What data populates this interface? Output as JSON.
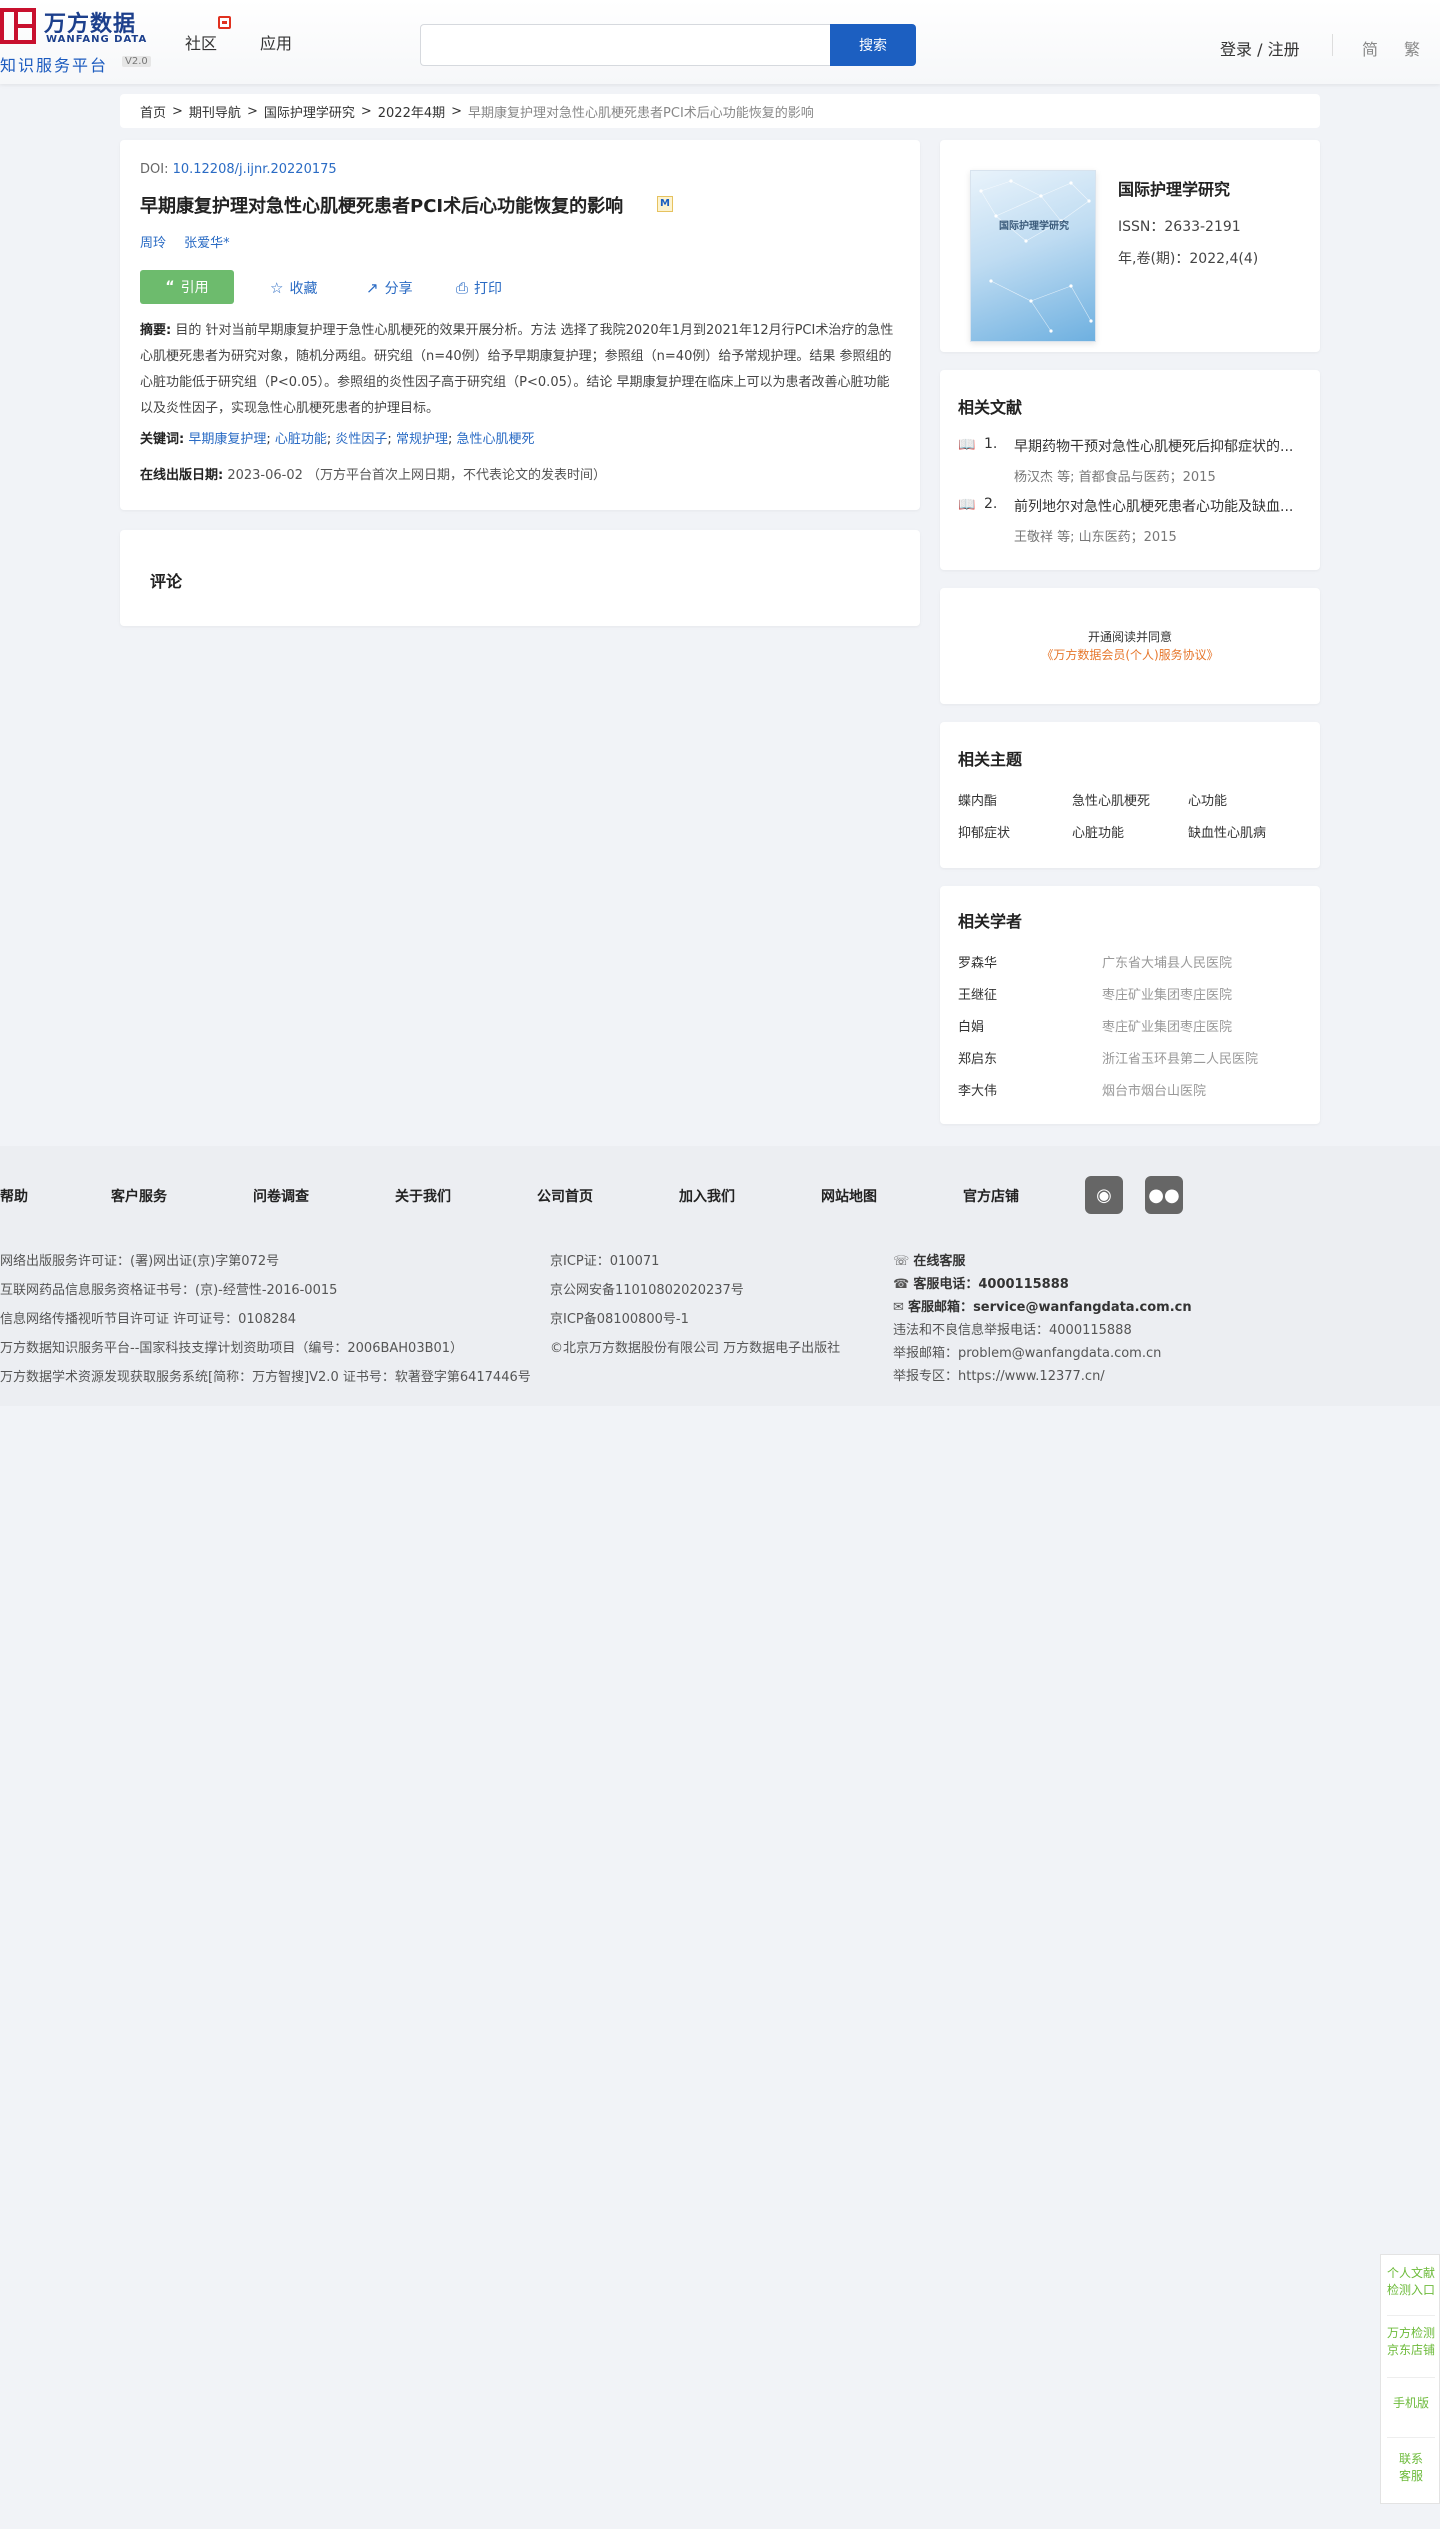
{
  "header": {
    "logo_cn": "万方数据",
    "logo_en": "WANFANG DATA",
    "logo_sub": "知识服务平台",
    "logo_version": "V2.0",
    "nav": [
      "社区",
      "应用"
    ],
    "search_placeholder": "",
    "search_button": "搜索",
    "login": "登录 / 注册",
    "lang_simplified": "简",
    "lang_traditional": "繁"
  },
  "breadcrumb": [
    "首页",
    "期刊导航",
    "国际护理学研究",
    "2022年4期",
    "早期康复护理对急性心肌梗死患者PCI术后心功能恢复的影响"
  ],
  "article": {
    "doi_label": "DOI: ",
    "doi": "10.12208/j.ijnr.20220175",
    "title": "早期康复护理对急性心肌梗死患者PCI术后心功能恢复的影响",
    "pdf_badge": "M",
    "authors": [
      "周玲",
      "张爱华*"
    ],
    "actions": {
      "cite": "引用",
      "favorite": "收藏",
      "share": "分享",
      "print": "打印"
    },
    "abstract_label": "摘要:",
    "abstract": "目的 针对当前早期康复护理于急性心肌梗死的效果开展分析。方法 选择了我院2020年1月到2021年12月行PCI术治疗的急性心肌梗死患者为研究对象，随机分两组。研究组（n=40例）给予早期康复护理；参照组（n=40例）给予常规护理。结果 参照组的心脏功能低于研究组（P<0.05）。参照组的炎性因子高于研究组（P<0.05）。结论 早期康复护理在临床上可以为患者改善心脏功能以及炎性因子，实现急性心肌梗死患者的护理目标。",
    "keywords_label": "关键词:",
    "keywords": [
      "早期康复护理",
      "心脏功能",
      "炎性因子",
      "常规护理",
      "急性心肌梗死"
    ],
    "pubdate_label": "在线出版日期:",
    "pubdate": "2023-06-02",
    "pubdate_note": "（万方平台首次上网日期，不代表论文的发表时间）"
  },
  "comments": {
    "title": "评论"
  },
  "journal": {
    "cover_title": "国际护理学研究",
    "name": "国际护理学研究",
    "issn": "ISSN：2633-2191",
    "volume": "年,卷(期)：2022,4(4)"
  },
  "related_docs": {
    "title": "相关文献",
    "items": [
      {
        "num": "1.",
        "title": "早期药物干预对急性心肌梗死后抑郁症状的...",
        "meta": "杨汉杰  等;  首都食品与医药；2015"
      },
      {
        "num": "2.",
        "title": "前列地尔对急性心肌梗死患者心功能及缺血...",
        "meta": "王敬祥  等;  山东医药；2015"
      }
    ]
  },
  "open_read": {
    "line1": "开通阅读并同意",
    "line2": "《万方数据会员(个人)服务协议》"
  },
  "related_topics": {
    "title": "相关主题",
    "items": [
      "蝶内酯",
      "急性心肌梗死",
      "心功能",
      "抑郁症状",
      "心脏功能",
      "缺血性心肌病"
    ]
  },
  "related_scholars": {
    "title": "相关学者",
    "items": [
      {
        "name": "罗森华",
        "org": "广东省大埔县人民医院"
      },
      {
        "name": "王继征",
        "org": "枣庄矿业集团枣庄医院"
      },
      {
        "name": "白娟",
        "org": "枣庄矿业集团枣庄医院"
      },
      {
        "name": "郑启东",
        "org": "浙江省玉环县第二人民医院"
      },
      {
        "name": "李大伟",
        "org": "烟台市烟台山医院"
      }
    ]
  },
  "footer": {
    "links": [
      "帮助",
      "客户服务",
      "问卷调查",
      "关于我们",
      "公司首页",
      "加入我们",
      "网站地图",
      "官方店铺"
    ],
    "col1": [
      "网络出版服务许可证：(署)网出证(京)字第072号",
      "互联网药品信息服务资格证书号：(京)-经营性-2016-0015",
      "信息网络传播视听节目许可证 许可证号：0108284",
      "万方数据知识服务平台--国家科技支撑计划资助项目（编号：2006BAH03B01）",
      "万方数据学术资源发现获取服务系统[简称：万方智搜]V2.0 证书号：软著登字第6417446号"
    ],
    "col2": [
      "京ICP证：010071",
      "京公网安备11010802020237号",
      "京ICP备08100800号-1",
      "©北京万方数据股份有限公司 万方数据电子出版社"
    ],
    "online_service": "在线客服",
    "phone_label": "客服电话：",
    "phone": "4000115888",
    "email_label": "客服邮箱：",
    "email": "service@wanfangdata.com.cn",
    "report_phone": "违法和不良信息举报电话：4000115888",
    "report_email": "举报邮箱：problem@wanfangdata.com.cn",
    "report_site": "举报专区：https://www.12377.cn/"
  },
  "float_bar": {
    "items": [
      [
        "个人文献",
        "检测入口"
      ],
      [
        "万方检测",
        "京东店铺"
      ],
      [
        "手机版"
      ],
      [
        "联系",
        "客服"
      ]
    ]
  }
}
